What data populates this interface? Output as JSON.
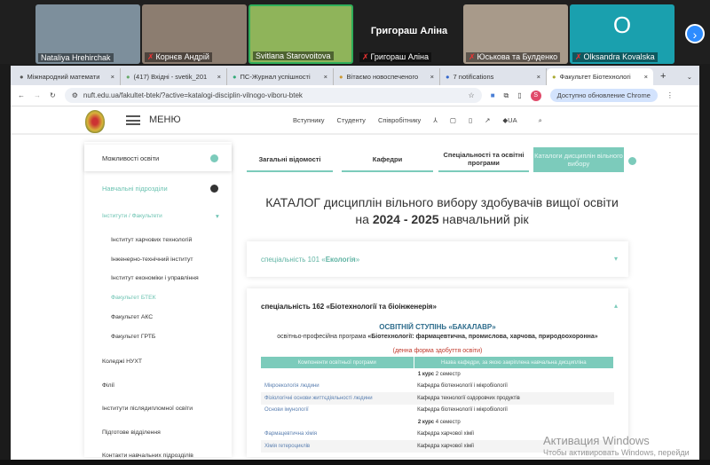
{
  "meeting": {
    "participants": [
      {
        "name": "Nataliya Hrehirchak",
        "muted": false,
        "bg": "#7d8f9c"
      },
      {
        "name": "Корнєв Андрій",
        "muted": true,
        "bg": "#8c7d70"
      },
      {
        "name": "Svitlana Starovoitova",
        "muted": false,
        "bg": "#8fb45a",
        "active": true
      },
      {
        "name": "Григораш Аліна",
        "muted": true,
        "bg": "#1f1f1f",
        "show_big": true
      },
      {
        "name": "Юськова та Булденко",
        "muted": true,
        "bg": "#a89a8a"
      },
      {
        "name": "Olksandra Kovalska",
        "muted": true,
        "bg": "#1aa0ae",
        "initial": "O"
      }
    ]
  },
  "browser": {
    "tabs": [
      "Міжнародний математи",
      "(417) Вхідні - svetik_201",
      "ПС-Журнал успішності",
      "Вітаємо новоспеченого",
      "7 notifications",
      "Факультет Біотехнологі"
    ],
    "url": "nuft.edu.ua/fakultet-btek/?active=katalogi-disciplin-vilnogo-viboru-btek",
    "update_label": "Доступно обновление Chrome",
    "profile_initial": "S"
  },
  "site": {
    "menu_label": "МЕНЮ",
    "nav": [
      "Вступнику",
      "Студенту",
      "Співробітнику",
      "UA"
    ],
    "sidebar": {
      "top": "Можливості освіти",
      "section": "Навчальні підрозділи",
      "group": "Інститути / Факультети",
      "subitems": [
        "Інститут харчових технологій",
        "Інженерно-технічний інститут",
        "Інститут економіки і управління",
        "Факультет БТЕК",
        "Факультет АКС",
        "Факультет ГРТБ"
      ],
      "items": [
        "Коледжі НУХТ",
        "Філії",
        "Інститути післядипломної освіти",
        "Підготове відділення",
        "Контакти навчальних підрозділів"
      ]
    },
    "tabs": [
      "Загальні відомості",
      "Кафедри",
      "Спеціальності та освітні програми",
      "Каталоги дисциплін вільного вибору"
    ],
    "title_line1": "КАТАЛОГ дисциплін вільного вибору здобувачів вищої освіти",
    "title_pre": "на ",
    "title_year": "2024 - 2025",
    "title_post": " навчальний рік",
    "acc1_prefix": "спеціальність 101 «",
    "acc1_name": "Екологія",
    "acc1_suffix": "»",
    "acc2": "спеціальність 162 «Біотехнології та біоінженерія»",
    "degree": "ОСВІТНІЙ СТУПІНЬ «БАКАЛАВР»",
    "program_prefix": "освітньо-професійна програма ",
    "program_name": "«Біотехнології: фармацевтична, промислова, харчова, природоохоронна»",
    "form": "(денна форма здобуття освіти)",
    "table": {
      "headers": [
        "Компоненти освітньої програми",
        "Назва кафедри, за якою закріплена навчальна дисципліна"
      ],
      "course1": {
        "bold": "1 курс",
        "rest": " 2 семестр"
      },
      "rows1": [
        [
          "Мікроекологія людини",
          "Кафедра біотехнології і мікробіології"
        ],
        [
          "Фізіологічні основи життєдіяльності людини",
          "Кафедра технології оздоровчих продуктів"
        ],
        [
          "Основи імунології",
          "Кафедра біотехнології і мікробіології"
        ]
      ],
      "course2": {
        "bold": "2 курс",
        "rest": " 4 семестр"
      },
      "rows2": [
        [
          "Фармацевтична хімія",
          "Кафедра харчової хімії"
        ],
        [
          "Хімія гетероциклів",
          "Кафедра харчової хімії"
        ]
      ]
    }
  },
  "watermark": {
    "line1": "Активация Windows",
    "line2": "Чтобы активировать Windows, перейди"
  }
}
